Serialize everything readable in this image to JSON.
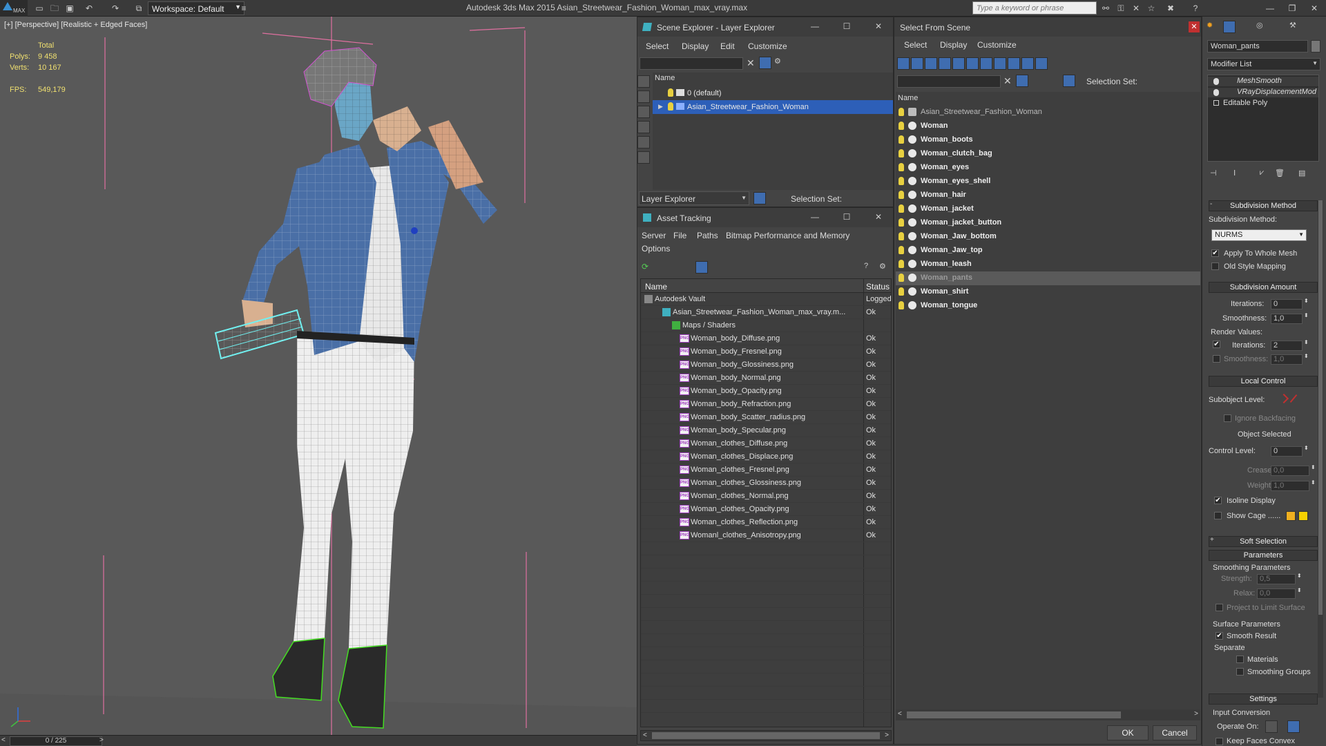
{
  "app": {
    "title": "Autodesk 3ds Max  2015    Asian_Streetwear_Fashion_Woman_max_vray.max",
    "logo": "MAX",
    "workspace_label": "Workspace: Default",
    "search_placeholder": "Type a keyword or phrase"
  },
  "viewport": {
    "label": "[+] [Perspective] [Realistic + Edged Faces]",
    "stats": {
      "total_label": "Total",
      "polys_label": "Polys:",
      "polys_value": "9 458",
      "verts_label": "Verts:",
      "verts_value": "10 167",
      "fps_label": "FPS:",
      "fps_value": "549,179"
    },
    "timeline_value": "0 / 225"
  },
  "layer_explorer": {
    "title": "Scene Explorer - Layer Explorer",
    "menu": [
      "Select",
      "Display",
      "Edit",
      "Customize"
    ],
    "column_name": "Name",
    "rows": [
      "0 (default)",
      "Asian_Streetwear_Fashion_Woman"
    ],
    "footer_dropdown": "Layer Explorer",
    "selection_set_label": "Selection Set:"
  },
  "asset_tracking": {
    "title": "Asset Tracking",
    "menu": [
      "Server",
      "File",
      "Paths",
      "Bitmap Performance and Memory",
      "Options"
    ],
    "col_name": "Name",
    "col_status": "Status",
    "vault": {
      "name": "Autodesk Vault",
      "status": "Logged"
    },
    "scene_file": {
      "name": "Asian_Streetwear_Fashion_Woman_max_vray.m...",
      "status": "Ok"
    },
    "maps_folder": "Maps / Shaders",
    "files": [
      {
        "name": "Woman_body_Diffuse.png",
        "status": "Ok"
      },
      {
        "name": "Woman_body_Fresnel.png",
        "status": "Ok"
      },
      {
        "name": "Woman_body_Glossiness.png",
        "status": "Ok"
      },
      {
        "name": "Woman_body_Normal.png",
        "status": "Ok"
      },
      {
        "name": "Woman_body_Opacity.png",
        "status": "Ok"
      },
      {
        "name": "Woman_body_Refraction.png",
        "status": "Ok"
      },
      {
        "name": "Woman_body_Scatter_radius.png",
        "status": "Ok"
      },
      {
        "name": "Woman_body_Specular.png",
        "status": "Ok"
      },
      {
        "name": "Woman_clothes_Diffuse.png",
        "status": "Ok"
      },
      {
        "name": "Woman_clothes_Displace.png",
        "status": "Ok"
      },
      {
        "name": "Woman_clothes_Fresnel.png",
        "status": "Ok"
      },
      {
        "name": "Woman_clothes_Glossiness.png",
        "status": "Ok"
      },
      {
        "name": "Woman_clothes_Normal.png",
        "status": "Ok"
      },
      {
        "name": "Woman_clothes_Opacity.png",
        "status": "Ok"
      },
      {
        "name": "Woman_clothes_Reflection.png",
        "status": "Ok"
      },
      {
        "name": "Womanl_clothes_Anisotropy.png",
        "status": "Ok"
      }
    ],
    "png_badge": "PNG"
  },
  "select_from_scene": {
    "title": "Select From Scene",
    "menu": [
      "Select",
      "Display",
      "Customize"
    ],
    "selection_set_label": "Selection Set:",
    "column_name": "Name",
    "objects": [
      "Asian_Streetwear_Fashion_Woman",
      "Woman",
      "Woman_boots",
      "Woman_clutch_bag",
      "Woman_eyes",
      "Woman_eyes_shell",
      "Woman_hair",
      "Woman_jacket",
      "Woman_jacket_button",
      "Woman_Jaw_bottom",
      "Woman_Jaw_top",
      "Woman_leash",
      "Woman_pants",
      "Woman_shirt",
      "Woman_tongue"
    ],
    "highlighted_index": 12,
    "ok_label": "OK",
    "cancel_label": "Cancel"
  },
  "command_panel": {
    "object_name": "Woman_pants",
    "modifier_list": "Modifier List",
    "stack": [
      "MeshSmooth",
      "VRayDisplacementMod",
      "Editable Poly"
    ],
    "subdivision_method": {
      "header": "Subdivision Method",
      "label": "Subdivision Method:",
      "value": "NURMS",
      "apply_whole_mesh": "Apply To Whole Mesh",
      "old_style_mapping": "Old Style Mapping"
    },
    "subdivision_amount": {
      "header": "Subdivision Amount",
      "iterations_label": "Iterations:",
      "iterations_value": "0",
      "smoothness_label": "Smoothness:",
      "smoothness_value": "1,0",
      "render_values_label": "Render Values:",
      "render_iterations_label": "Iterations:",
      "render_iterations_value": "2",
      "render_smoothness_label": "Smoothness:",
      "render_smoothness_value": "1,0"
    },
    "local_control": {
      "header": "Local Control",
      "subobject_label": "Subobject Level:",
      "ignore_backfacing": "Ignore Backfacing",
      "object_selected": "Object Selected",
      "control_level_label": "Control Level:",
      "control_level_value": "0",
      "crease_label": "Crease:",
      "crease_value": "0,0",
      "weight_label": "Weight:",
      "weight_value": "1,0",
      "isoline_display": "Isoline Display",
      "show_cage": "Show Cage ......",
      "cage_color_1": "#f0b020",
      "cage_color_2": "#f5d000"
    },
    "soft_selection": {
      "header": "Soft Selection"
    },
    "parameters": {
      "header": "Parameters",
      "smoothing_params": "Smoothing Parameters",
      "strength_label": "Strength:",
      "strength_value": "0,5",
      "relax_label": "Relax:",
      "relax_value": "0,0",
      "project_limit": "Project to Limit Surface",
      "surface_params": "Surface Parameters",
      "smooth_result": "Smooth Result",
      "separate_label": "Separate",
      "materials": "Materials",
      "smoothing_groups": "Smoothing Groups"
    },
    "settings": {
      "header": "Settings",
      "input_conversion": "Input Conversion",
      "operate_on": "Operate On:",
      "keep_faces_convex": "Keep Faces Convex"
    }
  }
}
